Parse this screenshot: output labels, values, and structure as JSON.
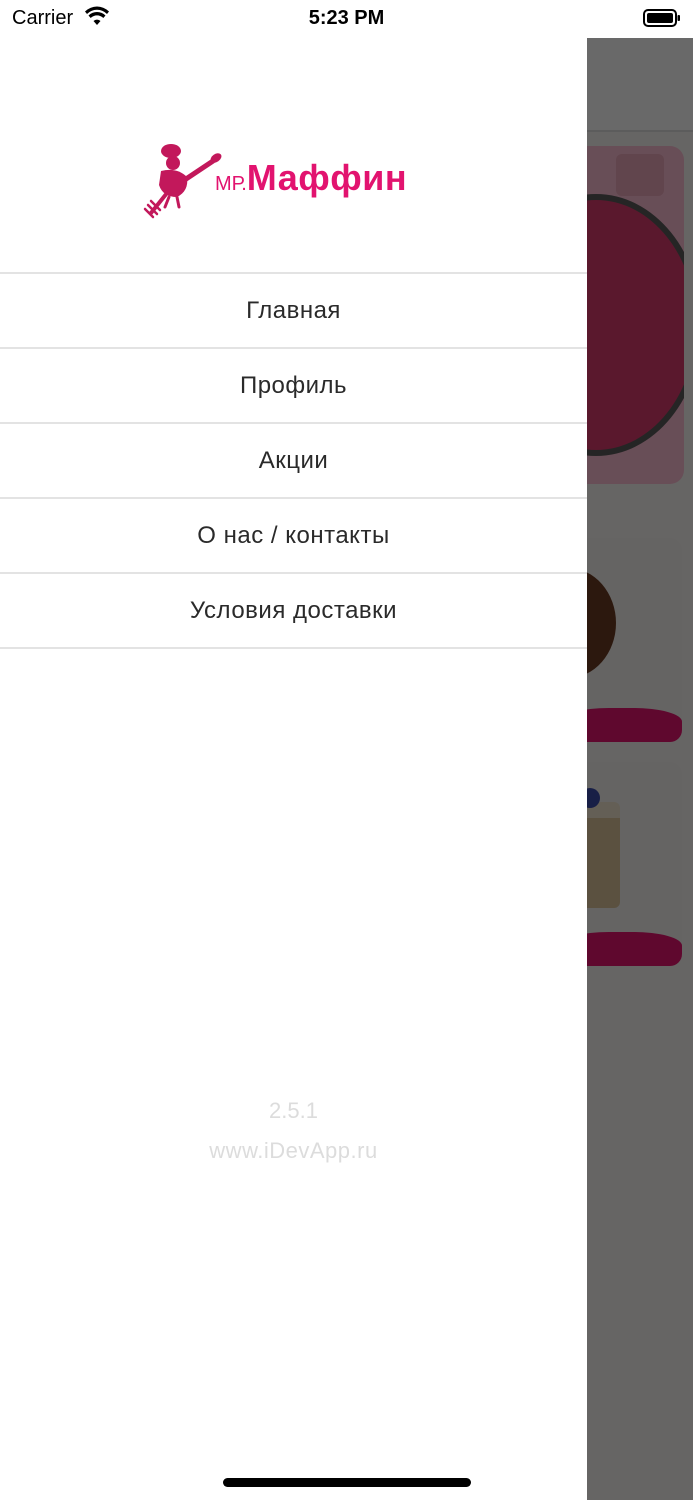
{
  "status_bar": {
    "carrier": "Carrier",
    "time": "5:23 PM"
  },
  "brand": {
    "prefix": "МР.",
    "name": "Маффин",
    "color": "#e2136f"
  },
  "menu": {
    "items": [
      {
        "label": "Главная"
      },
      {
        "label": "Профиль"
      },
      {
        "label": "Акции"
      },
      {
        "label": "О нас / контакты"
      },
      {
        "label": "Условия доставки"
      }
    ]
  },
  "footer": {
    "version": "2.5.1",
    "website": "www.iDevApp.ru"
  },
  "colors": {
    "overlay": "rgba(0,0,0,0.58)",
    "accent": "#e2136f",
    "divider": "#e3e3e3"
  }
}
